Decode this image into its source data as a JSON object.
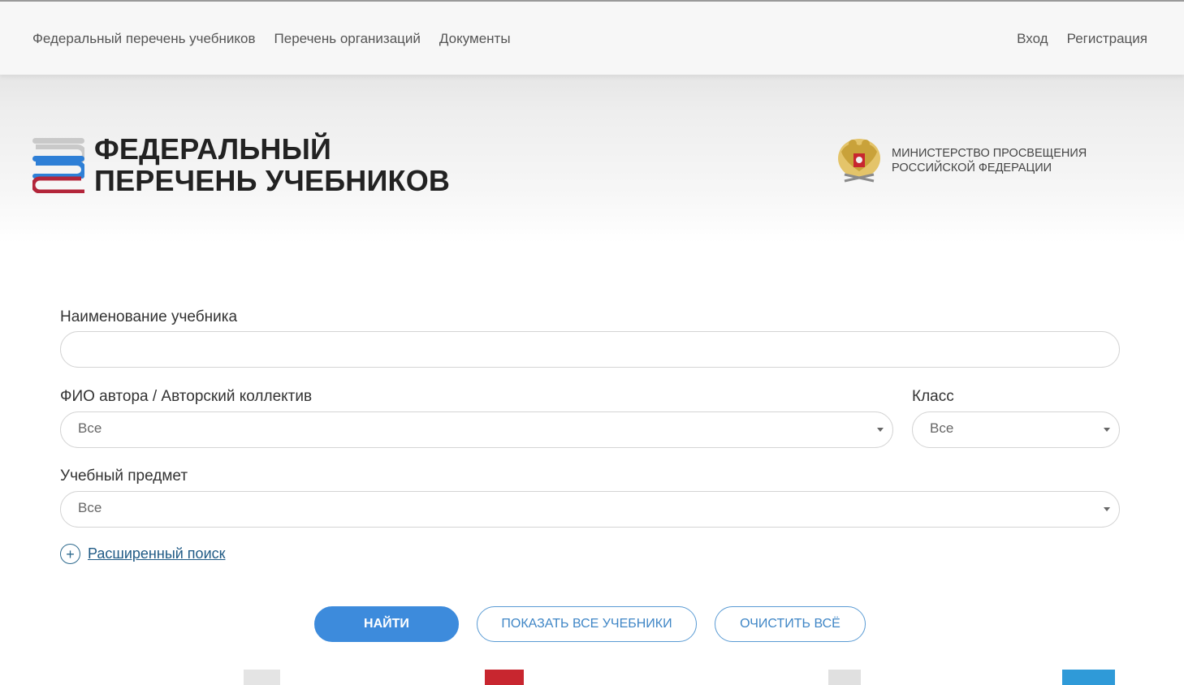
{
  "nav": {
    "left": [
      "Федеральный перечень учебников",
      "Перечень организаций",
      "Документы"
    ],
    "right": [
      "Вход",
      "Регистрация"
    ]
  },
  "header": {
    "title_line1": "ФЕДЕРАЛЬНЫЙ",
    "title_line2": "ПЕРЕЧЕНЬ УЧЕБНИКОВ",
    "ministry_line1": "МИНИСТЕРСТВО ПРОСВЕЩЕНИЯ",
    "ministry_line2": "РОССИЙСКОЙ ФЕДЕРАЦИИ"
  },
  "search": {
    "title_label": "Наименование учебника",
    "title_value": "",
    "author_label": "ФИО автора / Авторский коллектив",
    "author_value": "Все",
    "class_label": "Класс",
    "class_value": "Все",
    "subject_label": "Учебный предмет",
    "subject_value": "Все",
    "advanced_label": "Расширенный поиск"
  },
  "buttons": {
    "find": "НАЙТИ",
    "show_all": "ПОКАЗАТЬ ВСЕ УЧЕБНИКИ",
    "clear": "ОЧИСТИТЬ ВСЁ"
  },
  "colors": {
    "primary": "#3d8bdc",
    "link": "#1f5a85",
    "logo_blue": "#2e7fd6",
    "logo_red": "#b3253a",
    "logo_gray": "#c9c9c9"
  },
  "icons": {
    "logo": "books-logo-icon",
    "emblem": "russian-coat-of-arms-icon",
    "advanced": "plus-circle-icon",
    "dropdown": "caret-down-icon"
  }
}
